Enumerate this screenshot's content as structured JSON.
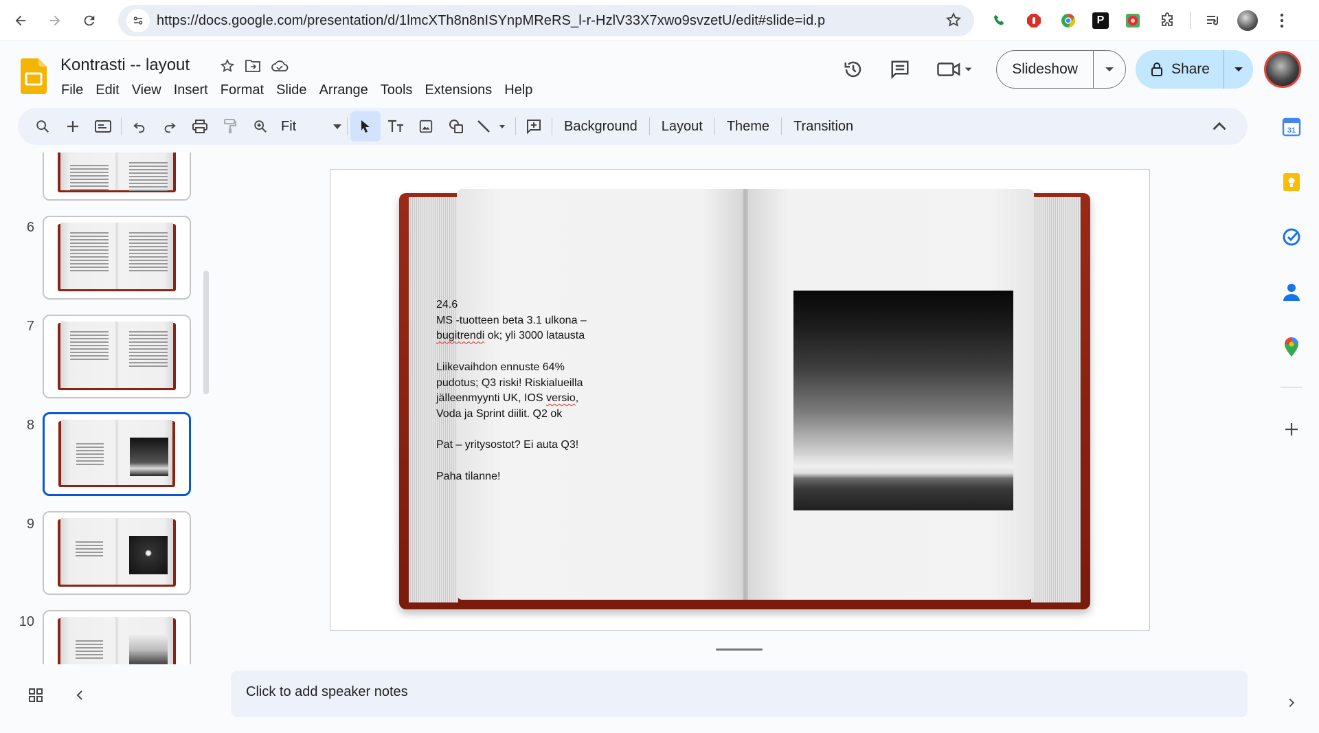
{
  "browser": {
    "url": "https://docs.google.com/presentation/d/1lmcXTh8n8nISYnpMReRS_l-r-HzlV33X7xwo9svzetU/edit#slide=id.p"
  },
  "doc": {
    "title": "Kontrasti -- layout"
  },
  "menu": [
    "File",
    "Edit",
    "View",
    "Insert",
    "Format",
    "Slide",
    "Arrange",
    "Tools",
    "Extensions",
    "Help"
  ],
  "header": {
    "slideshow_label": "Slideshow",
    "share_label": "Share"
  },
  "toolbar": {
    "zoom_value": "Fit",
    "background_label": "Background",
    "layout_label": "Layout",
    "theme_label": "Theme",
    "transition_label": "Transition"
  },
  "filmstrip": {
    "slides": [
      {
        "number": "6"
      },
      {
        "number": "7"
      },
      {
        "number": "8",
        "selected": true
      },
      {
        "number": "9"
      },
      {
        "number": "10"
      }
    ]
  },
  "slide": {
    "date": "24.6",
    "line1a": "MS -tuotteen beta 3.1 ulkona –",
    "line1b_pre": "",
    "line1b_spell": "bugitrendi",
    "line1b_post": " ok; yli 3000 latausta",
    "para2_l1": "Liikevaihdon ennuste 64%",
    "para2_l2": "pudotus; Q3 riski! Riskialueilla",
    "para2_l3_pre": "jälleenmyynti UK, IOS ",
    "para2_l3_spell": "versio",
    "para2_l3_post": ",",
    "para2_l4": "Voda ja Sprint diilit. Q2 ok",
    "para3": "Pat – yritysostot? Ei auta Q3!",
    "para4": "Paha tilanne!"
  },
  "notes": {
    "placeholder": "Click to add speaker notes"
  },
  "colors": {
    "accent": "#0b57d0",
    "share_bg": "#c2e7ff",
    "toolbar_bg": "#edf2fa",
    "cover_red": "#8b2314"
  }
}
